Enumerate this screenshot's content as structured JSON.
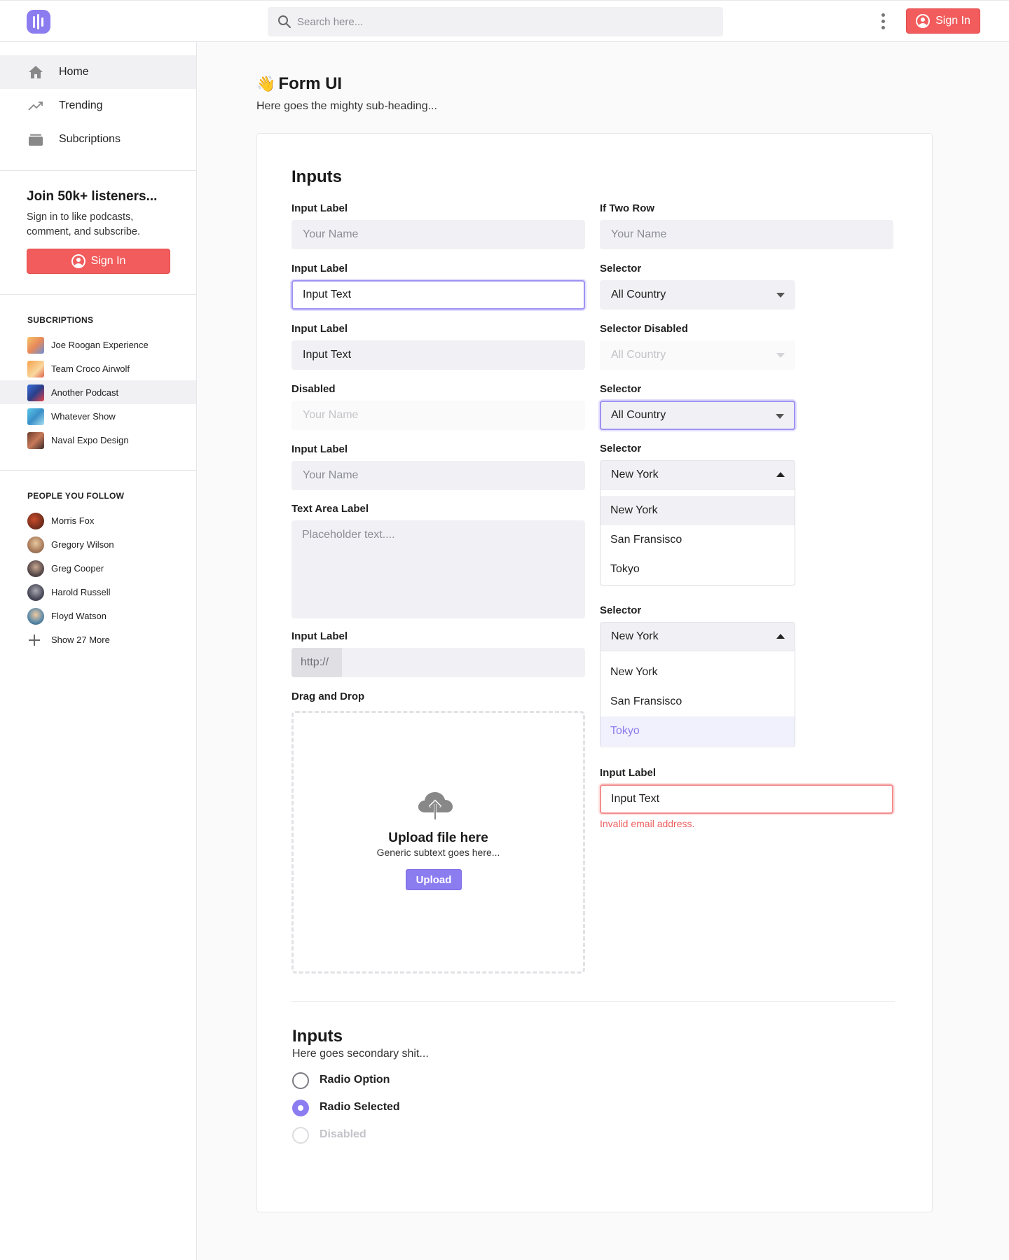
{
  "header": {
    "search_placeholder": "Search here...",
    "signin_label": "Sign In"
  },
  "sidebar": {
    "nav": [
      {
        "label": "Home",
        "icon": "home-icon"
      },
      {
        "label": "Trending",
        "icon": "trending-icon"
      },
      {
        "label": "Subcriptions",
        "icon": "subscriptions-icon"
      }
    ],
    "join_title": "Join 50k+ listeners...",
    "join_text": "Sign in to like podcasts, comment, and subscribe.",
    "signin_label": "Sign In",
    "subscriptions_title": "SUBCRIPTIONS",
    "subscriptions": [
      {
        "label": "Joe Roogan Experience"
      },
      {
        "label": "Team Croco Airwolf"
      },
      {
        "label": "Another Podcast"
      },
      {
        "label": "Whatever Show"
      },
      {
        "label": "Naval Expo Design"
      }
    ],
    "people_title": "PEOPLE YOU FOLLOW",
    "people": [
      {
        "label": "Morris Fox"
      },
      {
        "label": "Gregory Wilson"
      },
      {
        "label": "Greg Cooper"
      },
      {
        "label": "Harold Russell"
      },
      {
        "label": "Floyd Watson"
      }
    ],
    "show_more": "Show 27 More"
  },
  "main": {
    "title": "Form UI",
    "subtitle": "Here goes the mighty sub-heading...",
    "section1_title": "Inputs",
    "left": {
      "f1_label": "Input Label",
      "f1_placeholder": "Your Name",
      "f2_label": "Input Label",
      "f2_value": "Input Text",
      "f3_label": "Input Label",
      "f3_value": "Input Text",
      "f4_label": "Disabled",
      "f4_placeholder": "Your Name",
      "f5_label": "Input Label",
      "f5_placeholder": "Your Name",
      "textarea_label": "Text Area Label",
      "textarea_placeholder": "Placeholder text....",
      "url_label": "Input Label",
      "url_prefix": "http://",
      "dnd_label": "Drag and Drop",
      "upload_title": "Upload file here",
      "upload_sub": "Generic subtext goes here...",
      "upload_button": "Upload"
    },
    "right": {
      "r1_label": "If Two Row",
      "r1_placeholder": "Your Name",
      "s1_label": "Selector",
      "s1_value": "All Country",
      "s2_label": "Selector Disabled",
      "s2_value": "All Country",
      "s3_label": "Selector",
      "s3_value": "All Country",
      "s4_label": "Selector",
      "s4_value": "New York",
      "s4_options": [
        "New York",
        "San Fransisco",
        "Tokyo"
      ],
      "s5_label": "Selector",
      "s5_value": "New York",
      "s5_options": [
        "New York",
        "San Fransisco",
        "Tokyo"
      ],
      "err_label": "Input Label",
      "err_value": "Input Text",
      "err_message": "Invalid email address."
    },
    "section2_title": "Inputs",
    "section2_sub": "Here goes secondary shit...",
    "radios": [
      {
        "label": "Radio Option"
      },
      {
        "label": "Radio Selected"
      },
      {
        "label": "Disabled"
      }
    ]
  },
  "colors": {
    "accent": "#8b7cf0",
    "danger": "#f25c5c",
    "field_bg": "#f1f1f5"
  }
}
